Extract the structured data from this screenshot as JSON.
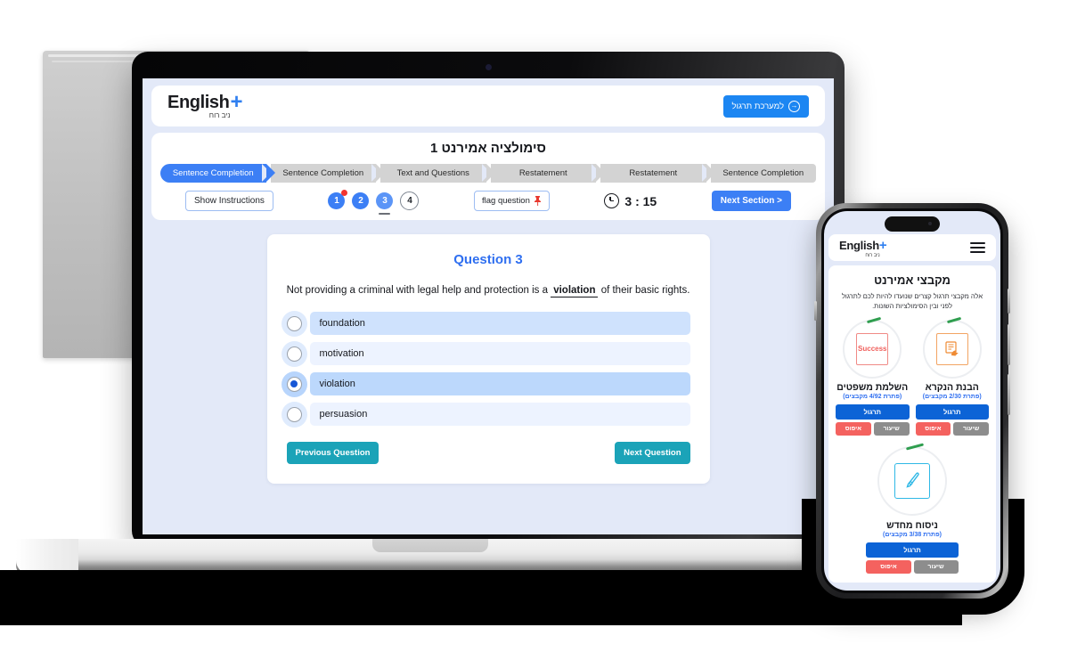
{
  "laptop": {
    "header": {
      "logo_main": "English",
      "logo_plus": "+",
      "logo_sub": "ניב רוח",
      "practice_button": "למערכת תרגול",
      "practice_icon": "circle-arrow-icon"
    },
    "simulation_title": "סימולציה אמירנט 1",
    "breadcrumbs": [
      {
        "label": "Sentence Completion",
        "active": true
      },
      {
        "label": "Sentence Completion",
        "active": false
      },
      {
        "label": "Text and Questions",
        "active": false
      },
      {
        "label": "Restatement",
        "active": false
      },
      {
        "label": "Restatement",
        "active": false
      },
      {
        "label": "Sentence Completion",
        "active": false
      }
    ],
    "toolbar": {
      "show_instructions": "Show Instructions",
      "question_numbers": [
        {
          "n": "1",
          "state": "done",
          "flagged": true
        },
        {
          "n": "2",
          "state": "done",
          "flagged": false
        },
        {
          "n": "3",
          "state": "current",
          "flagged": false
        },
        {
          "n": "4",
          "state": "todo",
          "flagged": false
        }
      ],
      "flag_question": "flag question",
      "flag_icon": "pin-icon",
      "clock_icon": "clock-icon",
      "timer": "3 : 15",
      "next_section": "Next Section >"
    },
    "question": {
      "title": "Question 3",
      "text_before": "Not providing a criminal with legal help and protection is a",
      "answer_word": "violation",
      "text_after": "of their basic rights.",
      "options": [
        {
          "label": "foundation",
          "selected": false,
          "highlighted": true
        },
        {
          "label": "motivation",
          "selected": false,
          "highlighted": false
        },
        {
          "label": "violation",
          "selected": true,
          "highlighted": false
        },
        {
          "label": "persuasion",
          "selected": false,
          "highlighted": false
        }
      ],
      "previous_button": "Previous Question",
      "next_button": "Next Question"
    }
  },
  "phone": {
    "header": {
      "logo_main": "English",
      "logo_plus": "+",
      "logo_sub": "ניב רוח",
      "menu_icon": "hamburger-menu-icon"
    },
    "title": "מקבצי אמירנט",
    "description": "אלה מקבצי תרגול קצרים שנועדו להיות לכם לתרגול לפני ובין הסימולציות השונות.",
    "cards": [
      {
        "title": "השלמת משפטים",
        "progress": "(פתרת 4/92 מקבצים)",
        "icon": "success-badge-icon",
        "icon_text": "Success",
        "primary_button": "תרגול",
        "reset_button": "איפוס",
        "lesson_button": "שיעור"
      },
      {
        "title": "הבנת הנקרא",
        "progress": "(פתרת 2/30 מקבצים)",
        "icon": "reading-hand-icon",
        "icon_text": "",
        "primary_button": "תרגול",
        "reset_button": "איפוס",
        "lesson_button": "שיעור"
      }
    ],
    "single_card": {
      "title": "ניסוח מחדש",
      "progress": "(פתרת 3/38 מקבצים)",
      "icon": "pen-write-icon",
      "primary_button": "תרגול",
      "reset_button": "איפוס",
      "lesson_button": "שיעור"
    }
  },
  "colors": {
    "brand_blue": "#3c7ff5",
    "teal": "#1ba3b8",
    "red": "#f4625f",
    "gray": "#8d8d8d",
    "page_bg": "#e3e9f8"
  }
}
